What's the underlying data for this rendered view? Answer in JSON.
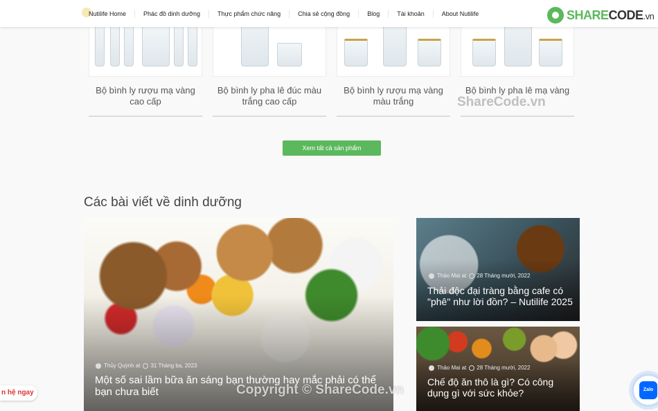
{
  "nav": {
    "items": [
      "Nutilife Home",
      "Phác đồ dinh dưỡng",
      "Thực phẩm chức năng",
      "Chia sẻ cộng đồng",
      "Blog",
      "Tài khoản",
      "About Nutilife"
    ]
  },
  "logo": {
    "part1": "SHARE",
    "part2": "CODE",
    "part3": ".vn"
  },
  "products": [
    {
      "name": "Bộ bình ly rượu mạ vàng cao cấp"
    },
    {
      "name": "Bộ bình ly pha lê đúc màu trắng cao cấp"
    },
    {
      "name": "Bộ bình ly rượu mạ vàng màu trắng"
    },
    {
      "name": "Bộ bình ly pha lê mạ vàng"
    }
  ],
  "view_all_label": "Xem tất cả sản phẩm",
  "articles_section_title": "Các bài viết về dinh dưỡng",
  "articles": [
    {
      "author": "Thủy Quỳnh at",
      "date": "31 Tháng ba, 2023",
      "title": "Một số sai lầm bữa ăn sáng bạn thường hay mắc phải có thể bạn chưa biết"
    },
    {
      "author": "Thảo Mai at",
      "date": "28 Tháng mười, 2022",
      "title": "Thải độc đại tràng bằng cafe có \"phê\" như lời đồn? – Nutilife 2025"
    },
    {
      "author": "Thảo Mai at",
      "date": "28 Tháng mười, 2022",
      "title": "Chế độ ăn thô là gì? Có công dụng gì với sức khỏe?"
    }
  ],
  "contact_label": "n hệ ngay",
  "zalo_label": "Zalo",
  "watermarks": {
    "top": "ShareCode.vn",
    "bottom": "Copyright © ShareCode.vn"
  }
}
